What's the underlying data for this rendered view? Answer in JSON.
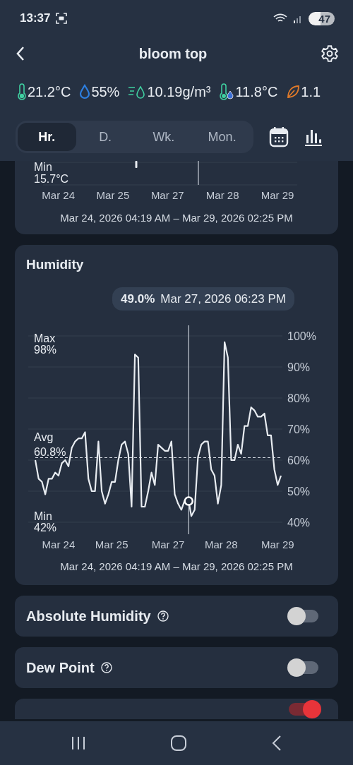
{
  "status_bar": {
    "time": "13:37",
    "battery": "47"
  },
  "app_bar": {
    "title": "bloom top"
  },
  "readings": [
    {
      "kind": "temperature",
      "value": "21.2°C"
    },
    {
      "kind": "humidity",
      "value": "55%"
    },
    {
      "kind": "absolute_humidity",
      "value": "10.19g/m³"
    },
    {
      "kind": "dew_point",
      "value": "11.8°C"
    },
    {
      "kind": "vpd",
      "value": "1.1"
    }
  ],
  "range_tabs": [
    {
      "label": "Hr.",
      "selected": true
    },
    {
      "label": "D.",
      "selected": false
    },
    {
      "label": "Wk.",
      "selected": false
    },
    {
      "label": "Mon.",
      "selected": false
    }
  ],
  "temperature_card": {
    "min_label": "Min",
    "min_value": "15.7°C",
    "x_labels": [
      "Mar 24",
      "Mar 25",
      "Mar 27",
      "Mar 28",
      "Mar 29"
    ],
    "range": "Mar 24, 2026 04:19 AM – Mar 29, 2026 02:25 PM"
  },
  "humidity_card": {
    "title": "Humidity",
    "tooltip": {
      "value": "49.0%",
      "time": "Mar 27, 2026 06:23 PM"
    },
    "max_label": "Max",
    "max_value": "98%",
    "avg_label": "Avg",
    "avg_value": "60.8%",
    "min_label": "Min",
    "min_value": "42%",
    "chart_data": {
      "type": "line",
      "ylim": [
        40,
        100
      ],
      "categories": [
        null,
        null,
        null,
        null,
        null,
        null,
        null,
        "Mar 24",
        null,
        null,
        null,
        null,
        null,
        null,
        null,
        null,
        null,
        null,
        null,
        null,
        null,
        null,
        null,
        "Mar 25",
        null,
        null,
        null,
        null,
        null,
        null,
        null,
        null,
        null,
        null,
        null,
        null,
        null,
        null,
        null,
        null,
        "Mar 27",
        null,
        null,
        null,
        null,
        null,
        null,
        null,
        null,
        null,
        null,
        null,
        null,
        null,
        null,
        null,
        "Mar 28",
        null,
        null,
        null,
        null,
        null,
        null,
        null,
        null,
        null,
        null,
        null,
        null,
        null,
        null,
        null,
        null,
        "Mar 29",
        null
      ],
      "yticks": [
        {
          "value": 100,
          "label": "100%"
        },
        {
          "value": 90,
          "label": "90%"
        },
        {
          "value": 80,
          "label": "80%"
        },
        {
          "value": 70,
          "label": "70%"
        },
        {
          "value": 60,
          "label": "60%"
        },
        {
          "value": 50,
          "label": "50%"
        },
        {
          "value": 40,
          "label": "40%"
        }
      ],
      "series": [
        {
          "color": "#e8ecf1",
          "values": [
            60,
            54,
            53,
            49,
            54,
            54,
            56,
            55,
            59,
            60,
            58,
            64,
            66,
            67,
            67,
            69,
            54,
            50,
            50,
            66,
            50,
            46,
            49,
            53,
            53,
            60,
            65,
            66,
            62,
            45,
            94,
            93,
            45,
            45,
            50,
            56,
            52,
            65,
            64,
            63,
            63,
            66,
            49,
            46,
            44,
            47,
            48,
            42,
            44,
            61,
            65,
            66,
            66,
            57,
            55,
            46,
            52,
            98,
            93,
            60,
            60,
            65,
            62,
            71,
            71,
            77,
            76,
            74,
            74,
            75,
            68,
            68,
            57,
            52,
            55
          ]
        }
      ],
      "grid": true,
      "ref_lines": [
        {
          "axis": "y",
          "value": 60.8
        }
      ]
    },
    "range": "Mar 24, 2026 04:19 AM – Mar 29, 2026 02:25 PM"
  },
  "toggles": [
    {
      "label": "Absolute Humidity",
      "on": false
    },
    {
      "label": "Dew Point",
      "on": false
    },
    {
      "on": true
    }
  ]
}
